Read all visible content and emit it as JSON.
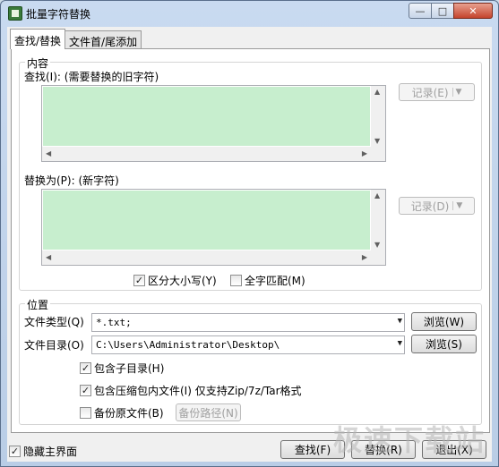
{
  "window": {
    "title": "批量字符替换",
    "min_icon": "minimize-icon",
    "max_icon": "maximize-icon",
    "close_icon": "close-icon"
  },
  "tabs": [
    {
      "label": "查找/替换"
    },
    {
      "label": "文件首/尾添加"
    }
  ],
  "content": {
    "group_title": "内容",
    "find_label": "查找(I): (需要替换的旧字符)",
    "find_value": "",
    "record1_label": "记录(E)",
    "replace_label": "替换为(P): (新字符)",
    "replace_value": "",
    "record2_label": "记录(D)",
    "case_sensitive_label": "区分大小写(Y)",
    "case_sensitive_checked": true,
    "whole_word_label": "全字匹配(M)",
    "whole_word_checked": false
  },
  "location": {
    "group_title": "位置",
    "file_type_label": "文件类型(Q)",
    "file_type_value": "*.txt;",
    "browse1_label": "浏览(W)",
    "dir_label": "文件目录(O)",
    "dir_value": "C:\\Users\\Administrator\\Desktop\\",
    "browse2_label": "浏览(S)",
    "include_sub_label": "包含子目录(H)",
    "include_sub_checked": true,
    "include_archive_label": "包含压缩包内文件(I) 仅支持Zip/7z/Tar格式",
    "include_archive_checked": true,
    "backup_label": "备份原文件(B)",
    "backup_checked": false,
    "backup_path_label": "备份路径(N)"
  },
  "footer": {
    "hide_main_label": "隐藏主界面",
    "hide_main_checked": true,
    "find_button": "查找(F)",
    "replace_button": "替换(R)",
    "exit_button": "退出(X)"
  },
  "watermark": "极速下载站"
}
